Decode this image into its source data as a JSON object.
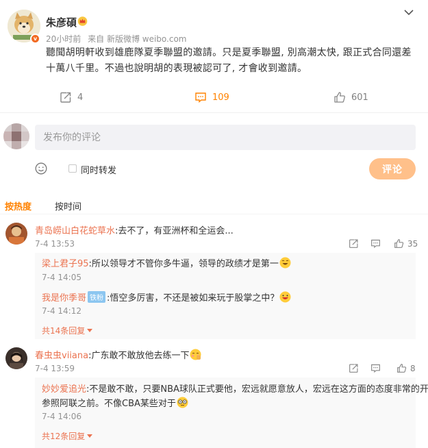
{
  "post": {
    "author": "朱彦碩",
    "time": "20小时前",
    "source_prefix": "来自",
    "source": "新版微博 weibo.com",
    "text": "聽聞胡明軒收到雄鹿隊夏季聯盟的邀請。只是夏季聯盟, 別高潮太快, 跟正式合同還差十萬八千里。不過也說明胡的表現被認可了, 才會收到邀請。",
    "actions": {
      "repost_count": "4",
      "comment_count": "109",
      "like_count": "601"
    }
  },
  "compose": {
    "placeholder": "发布你的评论",
    "also_repost_label": "同时转发",
    "submit_label": "评论"
  },
  "tabs": {
    "hot": "按热度",
    "time": "按时间"
  },
  "comments": [
    {
      "user": "青岛崂山白花蛇草水",
      "text": ":去不了，有亚洲杯和全运会...",
      "time": "7-4 13:53",
      "likes": "35",
      "replies": [
        {
          "user": "梁上君子95",
          "text": ":所以领导才不管你多牛逼，领导的政绩才是第一",
          "time": "7-4 14:05"
        },
        {
          "user": "我是你季哥",
          "badge": "铁粉",
          "text": ":悟空多厉害，不还是被如来玩于股掌之中？",
          "time": "7-4 14:12"
        }
      ],
      "more_replies": "共14条回复"
    },
    {
      "user": "春虫虫viiana",
      "text": ":广东敢不敢放他去练一下",
      "time": "7-4 13:59",
      "likes": "8",
      "replies": [
        {
          "user": "妙妙爱追光",
          "text": ":不是敢不敢，只要NBA球队正式要他，宏远就愿意放人，宏远在这方面的态度非常的开明，",
          "text2": "参照阿联之前。不像CBA某些对于",
          "time": "7-4 14:06"
        }
      ],
      "more_replies": "共12条回复"
    }
  ]
}
